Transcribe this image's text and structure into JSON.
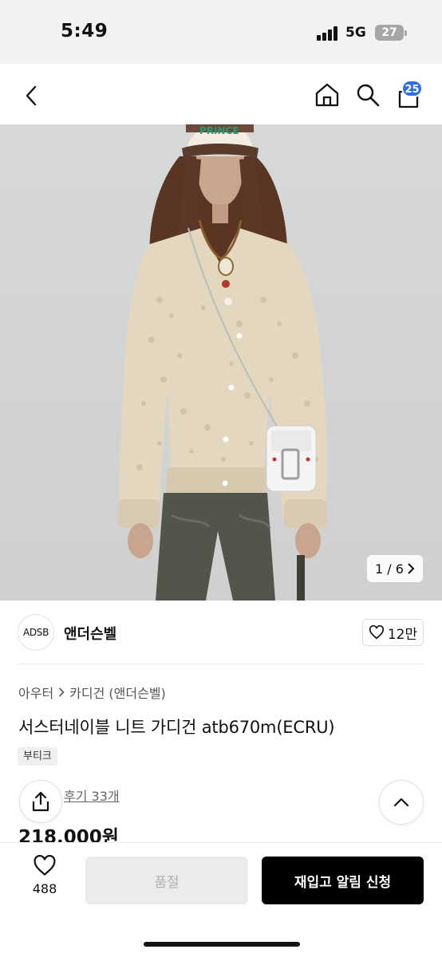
{
  "status": {
    "time": "5:49",
    "network": "5G",
    "battery": "27"
  },
  "nav": {
    "cart_count": "25"
  },
  "gallery": {
    "counter": "1 / 6",
    "prince_cap_text": "PRINCE"
  },
  "brand": {
    "logo_text": "ADSB",
    "name": "앤더슨벨",
    "likes": "12만"
  },
  "breadcrumb": {
    "category": "아우터",
    "subcategory": "카디건 (앤더슨벨)"
  },
  "product": {
    "title": "서스터네이블 니트 가디건 atb670m(ECRU)",
    "tag": "부티크",
    "reviews": "후기 33개",
    "price": "218,000원"
  },
  "bottom": {
    "wish_count": "488",
    "soldout_label": "품절",
    "restock_label": "재입고 알림 신청"
  },
  "colors": {
    "accent_badge": "#2d6de6",
    "primary_button": "#000000",
    "disabled_button": "#ebebeb"
  }
}
